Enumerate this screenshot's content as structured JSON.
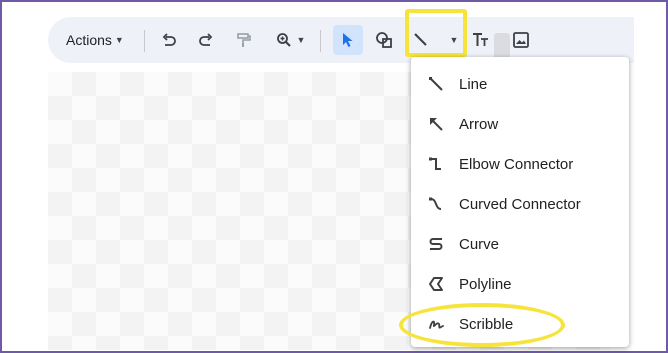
{
  "toolbar": {
    "actions_label": "Actions",
    "tools": [
      {
        "name": "undo-icon"
      },
      {
        "name": "redo-icon"
      },
      {
        "name": "paint-format-icon"
      },
      {
        "name": "zoom-icon"
      },
      {
        "name": "select-cursor-icon"
      },
      {
        "name": "shape-icon"
      },
      {
        "name": "line-icon"
      },
      {
        "name": "text-box-icon"
      },
      {
        "name": "image-icon"
      }
    ],
    "active_tool": "select-cursor-icon"
  },
  "line_menu": {
    "items": [
      {
        "label": "Line",
        "icon": "line-icon"
      },
      {
        "label": "Arrow",
        "icon": "arrow-icon"
      },
      {
        "label": "Elbow Connector",
        "icon": "elbow-connector-icon"
      },
      {
        "label": "Curved Connector",
        "icon": "curved-connector-icon"
      },
      {
        "label": "Curve",
        "icon": "curve-icon"
      },
      {
        "label": "Polyline",
        "icon": "polyline-icon"
      },
      {
        "label": "Scribble",
        "icon": "scribble-icon"
      }
    ]
  },
  "colors": {
    "highlight": "#f7e43a",
    "frame": "#6f5aa8",
    "toolbar_bg": "#eef2f8",
    "selected_tool_bg": "#d2e3fc",
    "select_icon": "#1a73e8"
  }
}
